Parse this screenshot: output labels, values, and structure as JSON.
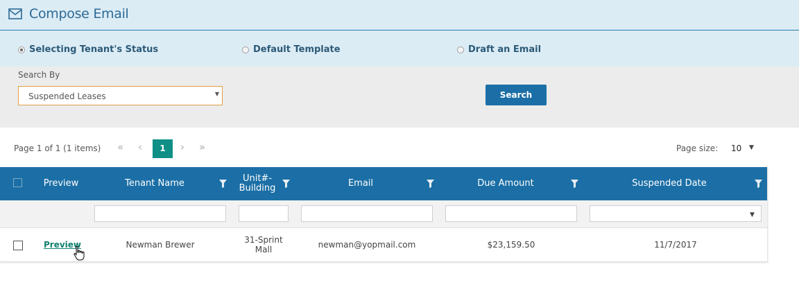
{
  "header": {
    "title": "Compose Email",
    "icon": "envelope-icon"
  },
  "steps": [
    {
      "label": "Selecting Tenant's Status",
      "selected": true
    },
    {
      "label": "Default Template",
      "selected": false
    },
    {
      "label": "Draft an Email",
      "selected": false
    }
  ],
  "search": {
    "label": "Search By",
    "selected": "Suspended Leases",
    "button": "Search"
  },
  "pager": {
    "info": "Page 1 of 1 (1 items)",
    "current_page": "1",
    "size_label": "Page size:",
    "size_value": "10"
  },
  "grid": {
    "columns": [
      "Preview",
      "Tenant Name",
      "Unit#-\nBuilding",
      "Email",
      "Due Amount",
      "Suspended Date"
    ],
    "rows": [
      {
        "preview": "Preview",
        "tenant_name": "Newman Brewer",
        "unit_building": "31-Sprint\nMall",
        "email": "newman@yopmail.com",
        "due_amount": "$23,159.50",
        "suspended_date": "11/7/2017"
      }
    ]
  },
  "colors": {
    "header_bg": "#dcecf5",
    "grid_head": "#1b6fa6",
    "page_active": "#0f8f86",
    "link": "#10806f"
  }
}
